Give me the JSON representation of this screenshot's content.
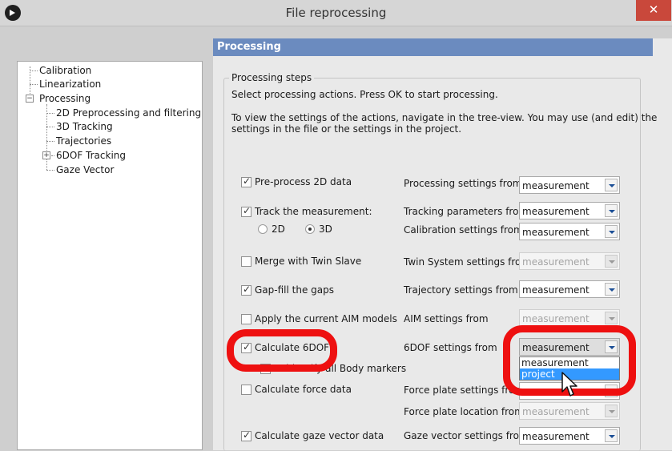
{
  "window": {
    "title": "File reprocessing",
    "close_label": "✕"
  },
  "tree": {
    "items": [
      {
        "label": "Calibration"
      },
      {
        "label": "Linearization"
      },
      {
        "label": "Processing",
        "expander": "−"
      },
      {
        "label": "2D Preprocessing and filtering"
      },
      {
        "label": "3D Tracking"
      },
      {
        "label": "Trajectories"
      },
      {
        "label": "6DOF Tracking",
        "expander": "+"
      },
      {
        "label": "Gaze Vector"
      }
    ]
  },
  "panel": {
    "header": "Processing",
    "group_title": "Processing steps",
    "intro": "Select processing actions. Press OK to start processing.",
    "help_line1": "To view the settings of the actions, navigate in the tree-view. You may use (and edit) the",
    "help_line2": "settings in the file or the settings in the project."
  },
  "steps": [
    {
      "label": "Pre-process 2D data",
      "checked": true,
      "setting_label": "Processing settings from",
      "value": "measurement",
      "enabled": true
    },
    {
      "label": "Track the measurement:",
      "checked": true,
      "setting_label": "Tracking parameters from",
      "value": "measurement",
      "enabled": true
    },
    {
      "label": "Merge with Twin Slave",
      "checked": false,
      "setting_label": "Twin System settings from",
      "value": "measurement",
      "enabled": false
    },
    {
      "label": "Gap-fill the gaps",
      "checked": true,
      "setting_label": "Trajectory settings from",
      "value": "measurement",
      "enabled": true
    },
    {
      "label": "Apply the current AIM models",
      "checked": false,
      "setting_label": "AIM settings from",
      "value": "measurement",
      "enabled": false
    },
    {
      "label": "Calculate 6DOF",
      "checked": true,
      "setting_label": "6DOF settings from",
      "value": "measurement",
      "enabled": true
    },
    {
      "label": "Calculate force data",
      "checked": false,
      "setting_label": "Force plate settings from",
      "value": "",
      "enabled": true
    },
    {
      "label": "Calculate gaze vector data",
      "checked": true,
      "setting_label": "Gaze vector settings from",
      "value": "measurement",
      "enabled": true
    }
  ],
  "tracking_mode": {
    "option_2d": "2D",
    "option_3d": "3D",
    "selected": "3D",
    "setting_label": "Calibration settings from",
    "value": "measurement"
  },
  "sub_option": {
    "label": "Reidentify all body markers",
    "visible_label": "Reidentify all Body markers"
  },
  "force_location": {
    "setting_label": "Force plate location from",
    "value": "measurement",
    "enabled": false
  },
  "open_dropdown": {
    "options": [
      "measurement",
      "project"
    ],
    "highlighted": "project"
  },
  "colors": {
    "accent": "#6b8bbf",
    "highlight_ring": "#ee1010",
    "selection": "#3399ff"
  }
}
